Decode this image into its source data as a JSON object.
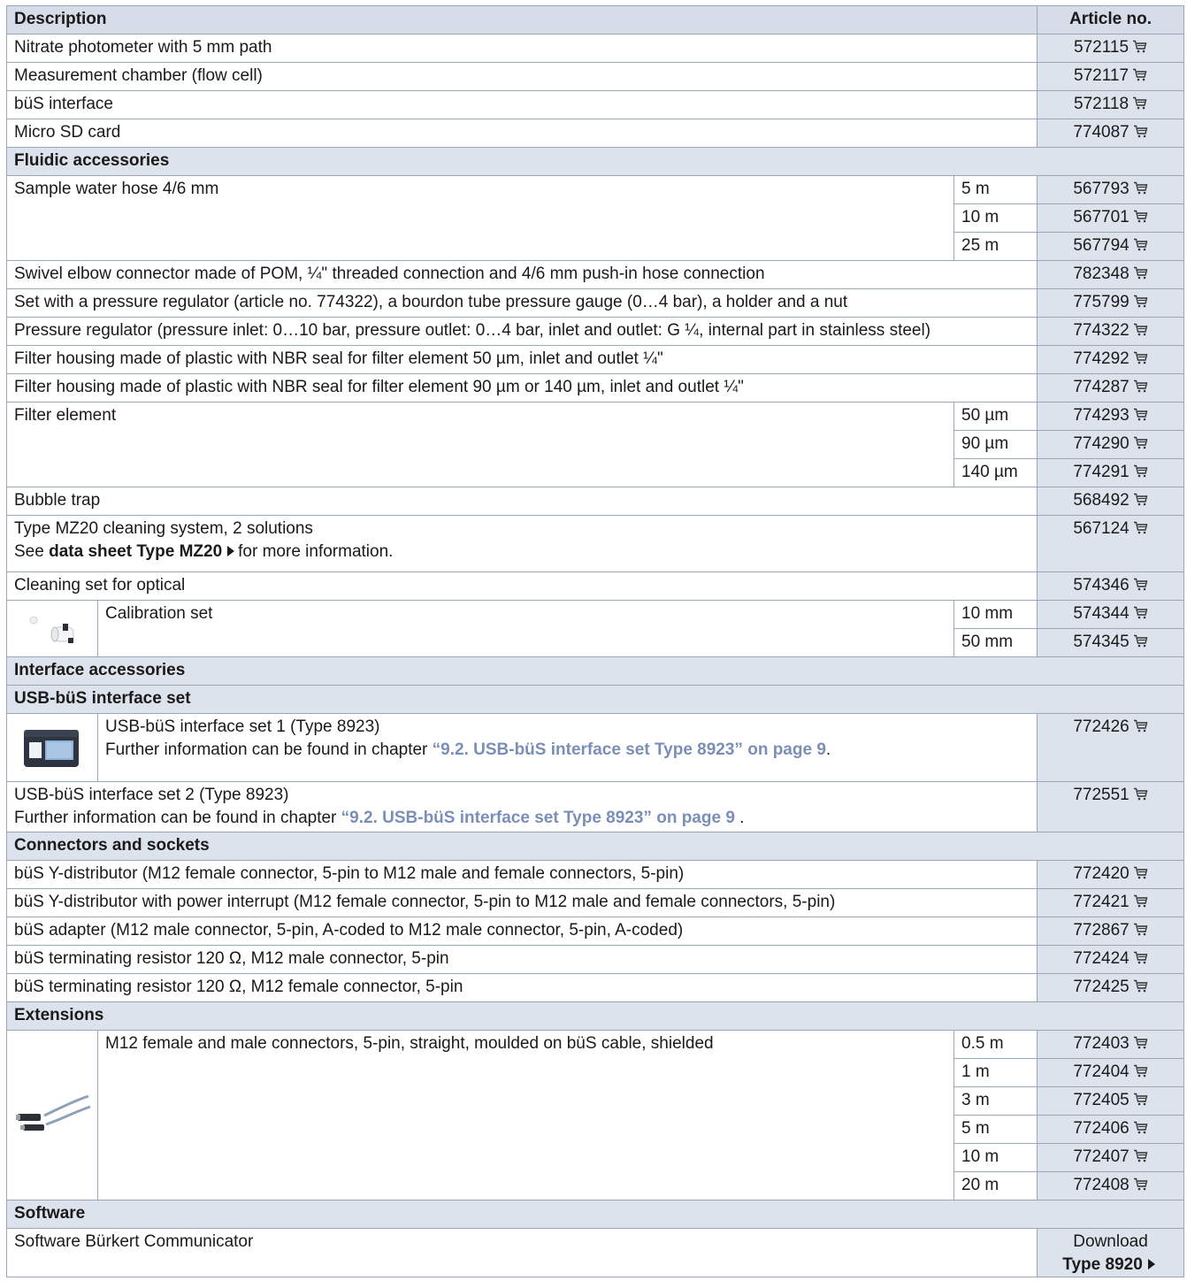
{
  "header": {
    "description": "Description",
    "article": "Article no."
  },
  "main_rows": [
    {
      "desc": "Nitrate photometer with 5 mm path",
      "art": "572115"
    },
    {
      "desc": "Measurement chamber (flow cell)",
      "art": "572117"
    },
    {
      "desc": "büS interface",
      "art": "572118"
    },
    {
      "desc": "Micro SD card",
      "art": "774087"
    }
  ],
  "fluidic": {
    "title": "Fluidic accessories",
    "hose": {
      "desc": "Sample water hose 4/6 mm",
      "variants": [
        {
          "size": "5 m",
          "art": "567793"
        },
        {
          "size": "10 m",
          "art": "567701"
        },
        {
          "size": "25 m",
          "art": "567794"
        }
      ]
    },
    "rows": [
      {
        "desc": "Swivel elbow connector made of POM, ¼\" threaded connection and 4/6 mm push-in hose connection",
        "art": "782348"
      },
      {
        "desc": "Set with a pressure regulator (article no. 774322), a bourdon tube pressure gauge (0…4 bar), a holder and a nut",
        "art": "775799"
      },
      {
        "desc": "Pressure regulator (pressure inlet: 0…10 bar, pressure outlet: 0…4 bar, inlet and outlet: G ¼, internal part in stainless steel)",
        "art": "774322"
      },
      {
        "desc": "Filter housing made of plastic with NBR seal for filter element 50 µm, inlet and outlet ¼\"",
        "art": "774292"
      },
      {
        "desc": "Filter housing made of plastic with NBR seal for filter element 90 µm or 140 µm, inlet and outlet ¼\"",
        "art": "774287"
      }
    ],
    "filter": {
      "desc": "Filter element",
      "variants": [
        {
          "size": "50 µm",
          "art": "774293"
        },
        {
          "size": "90 µm",
          "art": "774290"
        },
        {
          "size": "140 µm",
          "art": "774291"
        }
      ]
    },
    "bubble": {
      "desc": "Bubble trap",
      "art": "568492"
    },
    "mz20": {
      "line1": "Type MZ20 cleaning system, 2 solutions",
      "pre": "See ",
      "link": "data sheet Type MZ20",
      "post": "for more information.",
      "art": "567124"
    },
    "cleaning": {
      "desc": "Cleaning set for optical",
      "art": "574346"
    },
    "calibration": {
      "desc": "Calibration set",
      "variants": [
        {
          "size": "10 mm",
          "art": "574344"
        },
        {
          "size": "50 mm",
          "art": "574345"
        }
      ]
    }
  },
  "interface": {
    "title": "Interface accessories",
    "usb_title": "USB-büS interface set",
    "usb1": {
      "line1": "USB-büS interface set 1 (Type 8923)",
      "pre": "Further information can be found in chapter ",
      "link": "“9.2. USB-büS interface set Type 8923” on page 9",
      "post": ".",
      "art": "772426"
    },
    "usb2": {
      "line1": "USB-büS interface set 2 (Type 8923)",
      "pre": "Further information can be found in chapter ",
      "link": "“9.2. USB-büS interface set Type 8923” on page 9",
      "post": " .",
      "art": "772551"
    },
    "conn_title": "Connectors and sockets",
    "conn_rows": [
      {
        "desc": "büS Y-distributor (M12 female connector, 5-pin to M12 male and female connectors, 5-pin)",
        "art": "772420"
      },
      {
        "desc": "büS Y-distributor with power interrupt (M12 female connector, 5-pin to M12 male and female connectors, 5-pin)",
        "art": "772421"
      },
      {
        "desc": "büS adapter (M12 male connector, 5-pin, A-coded to M12 male connector, 5-pin, A-coded)",
        "art": "772867"
      },
      {
        "desc": "büS terminating resistor 120 Ω, M12 male connector, 5-pin",
        "art": "772424"
      },
      {
        "desc": "büS terminating resistor 120 Ω, M12 female connector, 5-pin",
        "art": "772425"
      }
    ],
    "ext_title": "Extensions",
    "ext": {
      "desc": "M12 female and male connectors, 5-pin, straight, moulded on büS cable, shielded",
      "variants": [
        {
          "size": "0.5 m",
          "art": "772403"
        },
        {
          "size": "1 m",
          "art": "772404"
        },
        {
          "size": "3 m",
          "art": "772405"
        },
        {
          "size": "5 m",
          "art": "772406"
        },
        {
          "size": "10 m",
          "art": "772407"
        },
        {
          "size": "20 m",
          "art": "772408"
        }
      ]
    }
  },
  "software": {
    "title": "Software",
    "desc": "Software Bürkert Communicator",
    "download": "Download",
    "type": "Type 8920"
  },
  "icons": {
    "cart": "shopping-cart-icon",
    "arrow": "triangle-right-icon"
  },
  "colors": {
    "header_bg": "#d6dde8",
    "article_bg": "#dde3ec",
    "border": "#9aa6b8",
    "link": "#7a8fb8"
  }
}
